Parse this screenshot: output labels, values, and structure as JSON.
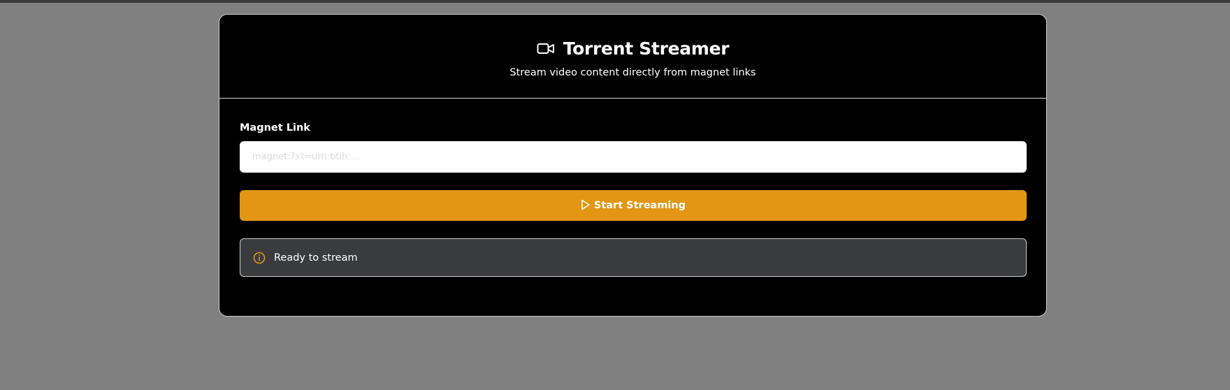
{
  "app": {
    "title": "Torrent Streamer",
    "subtitle": "Stream video content directly from magnet links",
    "title_icon": "video-camera-icon"
  },
  "form": {
    "magnet_label": "Magnet Link",
    "magnet_placeholder": "magnet:?xt=urn:btih:...",
    "magnet_value": "",
    "start_button_label": "Start Streaming",
    "start_button_icon": "play-icon"
  },
  "status": {
    "icon": "info-icon",
    "text": "Ready to stream"
  },
  "colors": {
    "background": "#808080",
    "card": "#000000",
    "accent": "#e29614",
    "status_box": "#3a3b3d"
  }
}
